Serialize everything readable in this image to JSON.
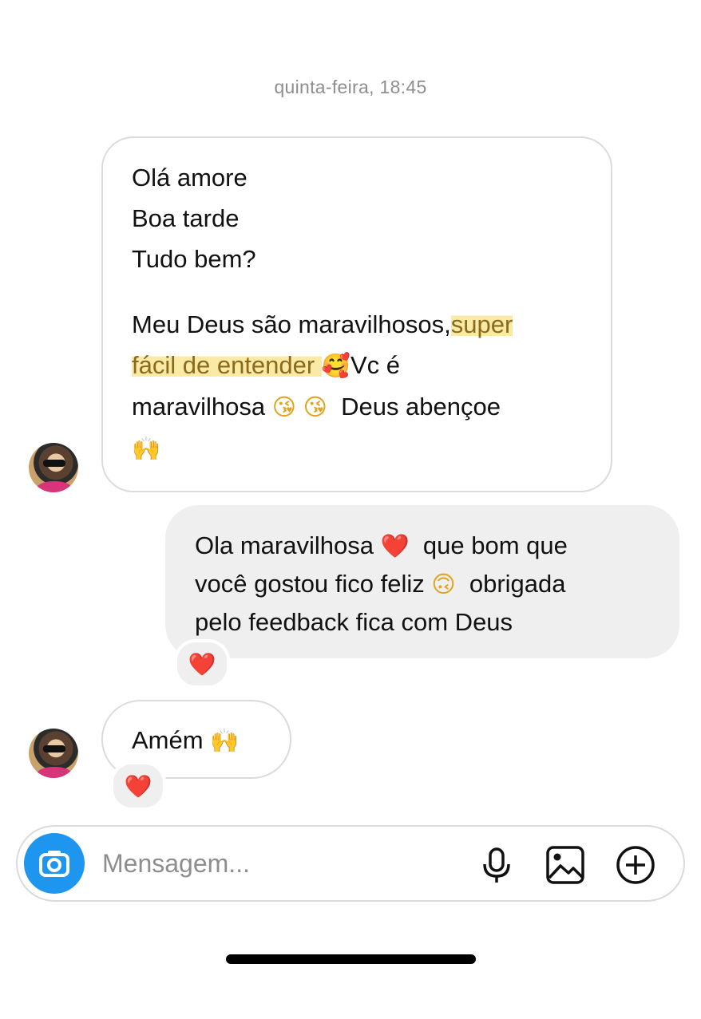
{
  "thread": {
    "timestamp": "quinta-feira, 18:45"
  },
  "messages": [
    {
      "sender": "other",
      "lines": [
        [
          "Olá amore"
        ],
        [
          "Boa tarde"
        ],
        [
          "Tudo bem?"
        ],
        [
          ""
        ],
        [
          "Meu Deus são maravilhosos,",
          {
            "hl": "super"
          }
        ],
        [
          {
            "hl": "fácil de entender "
          },
          {
            "emoji": "🥰"
          },
          "Vc é"
        ],
        [
          "maravilhosa ",
          {
            "emoji": "😘"
          },
          " ",
          {
            "emoji": "😘"
          },
          "  Deus abençoe"
        ],
        [
          {
            "emoji": "🙌"
          }
        ]
      ]
    },
    {
      "sender": "me",
      "lines": [
        [
          "Ola maravilhosa ",
          {
            "emoji": "❤️"
          },
          "  que bom que"
        ],
        [
          "você gostou fico feliz ",
          {
            "emoji": "🙃"
          },
          "  obrigada"
        ],
        [
          "pelo feedback fica com Deus"
        ]
      ],
      "reaction": "❤️"
    },
    {
      "sender": "other",
      "lines": [
        [
          "Amém ",
          {
            "emoji": "🙌"
          }
        ]
      ],
      "reaction": "❤️"
    }
  ],
  "composer": {
    "placeholder": "Mensagem...",
    "icons": [
      "camera-icon",
      "microphone-icon",
      "gallery-icon",
      "add-circle-icon"
    ]
  },
  "colors": {
    "accent": "#1e96f0",
    "highlight": "#fbe9a6",
    "outgoing_bubble": "#efefef",
    "incoming_border": "#dbdbdb"
  }
}
